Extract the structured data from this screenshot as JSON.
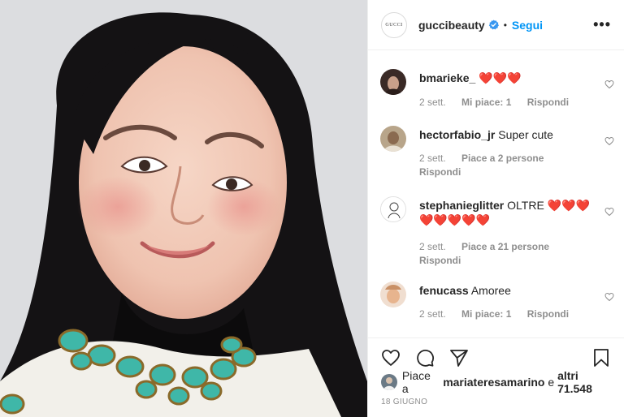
{
  "post": {
    "account": "guccibeauty",
    "verified": true,
    "follow_label": "Segui",
    "separator": "•",
    "more_label": "•••",
    "brand_logo_text": "GUCCI"
  },
  "comments": [
    {
      "user": "bmarieke_",
      "text": "❤️❤️❤️",
      "time": "2 sett.",
      "likes": "Mi piace: 1",
      "reply": "Rispondi"
    },
    {
      "user": "hectorfabio_jr",
      "text": "Super cute",
      "time": "2 sett.",
      "likes": "Piace a 2 persone",
      "reply": "Rispondi"
    },
    {
      "user": "stephanieglitter",
      "text": "OLTRE ❤️❤️❤️❤️❤️❤️❤️❤️",
      "time": "2 sett.",
      "likes": "Piace a 21 persone",
      "reply": "Rispondi"
    },
    {
      "user": "fenucass",
      "text": "Amoree",
      "time": "2 sett.",
      "likes": "Mi piace: 1",
      "reply": "Rispondi"
    }
  ],
  "likes_line": {
    "prefix": "Piace a",
    "user": "mariateresamarino",
    "conj": "e",
    "others": "altri 71.548"
  },
  "date": "18 GIUGNO",
  "colors": {
    "accent": "#0095f6",
    "text": "#262626",
    "muted": "#8e8e8e",
    "heart": "#e0102a"
  },
  "icons": [
    "heart-icon",
    "comment-icon",
    "share-icon",
    "bookmark-icon",
    "more-icon",
    "verified-badge-icon"
  ]
}
